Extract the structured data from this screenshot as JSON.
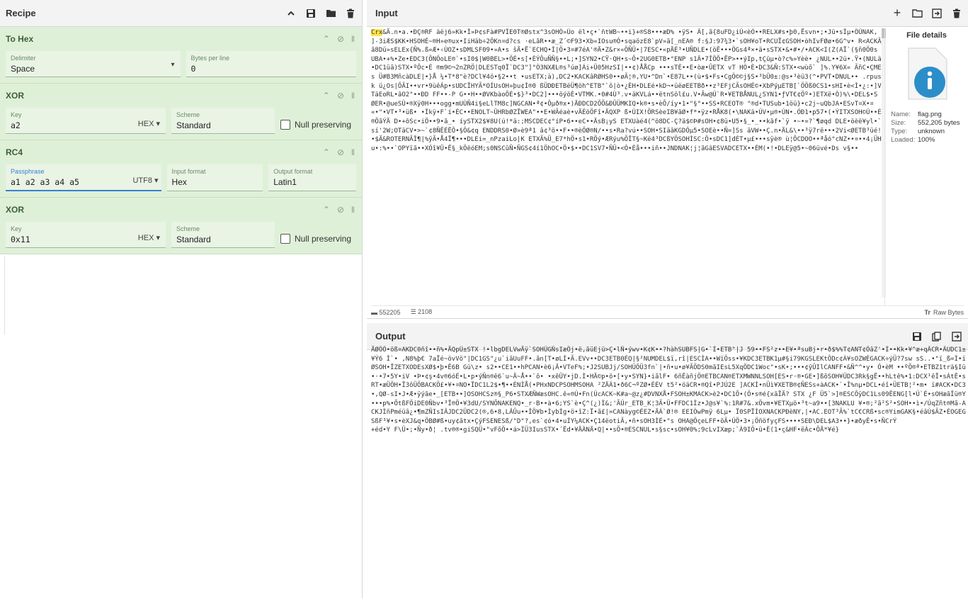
{
  "recipe": {
    "title": "Recipe",
    "operations": [
      {
        "name": "To Hex",
        "fields": [
          {
            "label": "Delimiter",
            "value": "Space"
          },
          {
            "label": "Bytes per line",
            "value": "0"
          }
        ]
      },
      {
        "name": "XOR",
        "key_label": "Key",
        "key_value": "a2",
        "key_format": "HEX",
        "scheme_label": "Scheme",
        "scheme_value": "Standard",
        "null_label": "Null preserving"
      },
      {
        "name": "RC4",
        "passphrase_label": "Passphrase",
        "passphrase_value": "a1 a2 a3 a4 a5",
        "passphrase_format": "UTF8",
        "input_label": "Input format",
        "input_value": "Hex",
        "output_label": "Output format",
        "output_value": "Latin1"
      },
      {
        "name": "XOR",
        "key_label": "Key",
        "key_value": "0x11",
        "key_format": "HEX",
        "scheme_label": "Scheme",
        "scheme_value": "Standard",
        "null_label": "Null preserving"
      }
    ]
  },
  "input": {
    "title": "Input",
    "highlight": "Crx",
    "text": "&Ä.n•a.•ÐÇ®RF äëj6»Kk•Î»Þ¢sFà#PVÎE0T®Østx^3sOHÖ»Üo ël•ç•`ñtWB~••i}+®S8•••æD% •ÿS• Ã[,ã{8uFD¿iÛ<èÒ••RELX#s•þ0,Ësvn•;•Jü•sÎµ•ÖÛNAK, ]-3iÆS$KK•HSOHÉ~®H»e®ux•IiHäb÷2ÖKn¤d?cs ·eLãR••æ_Z´©F93•Xb«IOsu®Ó•sqaözE8`pV»ã[_nEA® f:§J:97¾3•`sOH¥oT•RCUÏ¢GSOH•òhIvFØø•6G^v• R<ACKÃã8Dü»sELEx{Ñ%.ß«Æ•‹ÙOZ•sDMLSF09•»A•s šÄ•Ë`ECHQ•Ì|Ö•3¤#7éA'®Ä•Z&r×«ÖÑÜ•|7ESC•«pÄÉ³•UÑDLE•(öÊ•••ÖGs4ª×•ä•sSTX•&•#•/•ACK<I(Z(AÏ`(§ñ0Ö0s UBA•+%•Ze•EDC3(ÕNÖoLE®`•sI0$|W0BEL>•ÖÉ•s[•ÈÝÔuÑÑ§••L;•]SYN2•CŸ·QH•s~Ô•2UG0ETB•°ENP s1Â•7ÎÖÕ•ËP>••ýIp,tÇüµ•ò?c%»Yèè• ¿NUL••2ü•.Ÿ•(NULä•DC1üã)STX•ºÔc•É ®m9©¬2nZRÖ|DLESTq0Ï`DC3\"]°Ò3NXÆL®s³úø]Ái+Ü05HzSI|••¢)ÅÅCp •••sTÈ••E•òæ•ÛETX vT HÒ•È•DC3&Ñ:STX•<wùõ` ]%.Y¥6X« ÃñC•ÇMEs Ü#B3MñcàDLE|•}Å ¼•T*8\"è?DCl¥4ö•§2••t •usETX;à),DC2•KACKâRØHS0••øÃ¦®,YU•^Dn`•E87L••(ù•$•Fs•CgÖ©©j§S•³bÜ0±:@s•³èü3(^•PVT•DNUL•• .rpusk ü¿Os|ÕÃI••vr•9ùêÁp•sUDCÏHYÃ*OÍUsOH»þu¢Í®0 ßÜDÐETBëÜ¶öh^ETB\"`ô|ò•¿ÈH•DLEé•kD¬•üëøEETBð••z³EFjCÃsOHÉ©•XbPýµETB[`ÖÖß0CS1•sHI•è<Ì•¿:•]VTäEoRL•âO2\"••ÐD FF••-P G••H••ØVKbàoÕÉ•$}³•DC2]•••öýöÈ•VTMK.•0#4Ù³.v•äKVLá••ëtnSöl£u.V•Ãw@Ú`R•¥ETBÅNUL¿SYN1•ƒVT€¢Öº•)ETXë•Ò)%\\•DEL$•S ØER•@ueSÙ•®Xÿ0H•••ogg•mUÙÑ4i§eLlTM8c]NGCAN•ª¢•Ôµð®x•)ÄÐDCD2ÕÕ&ÐÛÜMKIQ•k®•s•èÕ/íy•1•\"§°••SS•RCEOT® \"®d•TUSub•1öü}•c2j~uQbJA•ESvT¤X•¤ «•\"•VT•³•üß• •Îkÿ•F`í•ÈC••ENOLT~ÜHRbØZÏWEA\"••E•WÃéaè•vÄÉöÖFî•ÄQXP ß•ÙIX!ÕRSèeIB¥ãØ•f*•ÿz•RÅK8(•\\NAKä•ÚV•µ®•ÚN•.ÓÐ1•p57•(•ÝITXSOH©Ú••É®ÕãÝÄ D•+ôSc•iÖ••9•ã_• íySTX2$¥8U(ú!*ä:;MSCDEC¢°íP•6••eC••ÄsB¡yS ETXUàé4(^ö8DC-Ç?ä$©Þ#sOH•¢8ü•U5•§_•_••kâf•`ÿ •~•=?`¶øqd DLE•öèë¥yl•`sí'2W;OTäCV•>~`¢8ÑÊÉËÔ•§Ö&¢q ENDDRS0•Ø»è9ª1 â¢³ö••F••®èÖØ®N/••s•Ra?vú••SOH•SIäâKGDÖµ5•SOEè••Ñ=]Ss äVW••Ç.n•ÄL&\\••³ÿ7rë•••2Vi<ØETB³üé!•$Ä&ROTERNÃÎ¶|%ÿÃ•Å4Ï¶•••DLEi=_nPzaiLo|K ETXÃ%Ü_E7*hÖ•s1•RÖý•ÆRýu%ÕÎT§~Kë4³DCßYÖSOHÌSC:Ö•sDC1]dÉT•µ£•••sÿè® ù¦ÕCDOO••ªåó°cNZ••¤••4¡ÜHu•:%••`OPYïã••XÓî¥Ü•Ë§_kÖëóEM;s0NSCûÑ•ÑGS¢4í1ÖhOC•Ö•$••DC1SV7•ÑÜ•<Ó•Èå•••iñ••JNDNAK¦j¦ãGâESVADCETX••ÉM(•!•DLEÿ@5•~06üvé•Ds v§••",
    "length": "552205",
    "lines": "2108",
    "font_label": "Raw Bytes"
  },
  "file_details": {
    "title": "File details",
    "name_label": "Name:",
    "name_value": "flag.png",
    "size_label": "Size:",
    "size_value": "552,205 bytes",
    "type_label": "Type:",
    "type_value": "unknown",
    "loaded_label": "Loaded:",
    "loaded_value": "100%"
  },
  "output": {
    "title": "Output",
    "text": "ÄØÖÕ•öß¤AKDC0ñî••ñ%•ÄQpÜ±STX !•lbgDELVwÄÿ`SOHÜGÑsIæÕj•ë,ãüEjü>Ç•lÑ•ýwv•K¢K••?hàhSUBFS|G•`Í•ETB\"|J 59••FS²z••E¥•ªsuBj•r•ð$%%T¢ANT¢ÕâZ'•Í••Kk•¥^æ+qÃCR•ÃUDC1±¥Ý6 Ì`• ,N8%þ€ 7aÏé~övVö\"|DC1GS\"¿u`iãUuFF•.ãn[T•øLÍ•Ã.EVv••DC3ETB0ÈQ|§²NUMDEL$ï,rî|ESCÌA••WïÖss•¥KDC3ETBK1µ#§i79KGSLEKtÔDc¢À¥sOZWÈGACK÷ýÜ?7sw sS..•\"ï_ß=Ì•ïØSOH•ÏZETXODEsXØ$•þ•Ê6B Gü\\z• s2••CE1••hPCAN•è6¡Ä•VTeF%;•J2SUBJj/SOHÜÖÜ3fn`|•ñ•u•ø¥ÃÖDS0mãIEsL5XqÖDC1Woc\"•sK•;•••¢ŷÛIlCANFF•&Ñ^^•y• Ó•èM ••ºÕ®ª•ETBZ1trä§Iü•·•7•5Y•iV •Þ•¢ş•4v®6óÉ•L•p•ýÑn®ê6`u~Ä~Å••`ô• •xêÜY•jD.Ì•HÄ©p•ö•[•y•SYN}•iãlF• 6ñÊàñjÖ®ETBCAN®ETXMWNNLSOH[ES•r·®•GE•]ßõSOH¥ÜDC3Rk§gË••hLtê%•1:DCX¹êÏ•sÁtÊ•sRT•æÜÖH•Ï3ôÜÖBACKÕ£•¥•¤NO•ÏDC1L2$•¶••ÉNÌÅ(•PHxNDCPSOHMSOHA ²ZÄÁ1•ð6C¬ºZØ•ÉÉV t5²•öäCR•®Qî•PJÚ2E ]ACKÌ•nÜì¥XETB®¢ÑESs+àACK•`•Î%nµ•DCL•éî•ÜETB¦²•m• ï#ACK•DC3•,QØ-sI•J•Æ•ÿýãe•_[ETB••]OSOHCSz®§_P6•STXÆÑWæsOHC.ê«®Ú•Fn(ÚcACK~K#a~@z¿#DVNXÅ•FSOH±KMACK>è2•DC1Õ•(Ö•s®é{xãÏÄ? STX ¿F Ü5`>]®ESCÔÿDC1Ls09ÊENG[l•Ú`É•sOHæãÎü®Y•••p%•ÕtßFÖiDE0Ñbv•³Ï®Ö•¥3dU/SYNÕNAKENQ•_r·B••à•6;YS`è•Ç^(¿)Ì&;'ÃÚr_ETB_K¦3Ã•Ü•FFDC1Ìz•J@s¥`%:1R#7&.xÖvm•¥ETXµö•³t~a9••[3NAKLU ¥•®;²ã²S²•SOH••ì•/ÚqZñt®Mã-ACKJÌñPméüâ¿•¶mZÑIsIÂJDC2ÜDC2(®,6•8,LÂÛu••ÎÖ¥b•ÌybÍg•ö•îZ:Ï•ã£|=CANàyg©ÉEZ•ÄÁ`Ø!® EEIÒwPmÿ 6Lµ• Ï0SPÏÌOXNACKPÐèNY,|•AC.EOT³Ã%`tC€CRß•sc®YimGAK§•éâÙ$ÃZ•ÉOGEGSßF³¥•s•èXJ&q•ÖBØ#ß•uy¢ãtx•ÇýFSENESß/\"D\"?,es`¢ó•4•uÍY¼ACK•Ç14ëotiÃ,•ñ•sOH3ÌÉ•\"s OHA@ÖçeLFF•õÃ•ÚÖ•3•¡ÖñöfyçFS••••SEÐ\\DEL$A3••}•æðyÊ•s•ÑCrÝ",
    "more": "+éd•Y F\\Ü•;•Ñy•ð¦ .tv®®•giSQÜ•\"vFõÖ••á>ÍÜ3IusSTX•´Ëd•¥ÄÀNÄ•Q|••sÖ•®ESCNUL•s§sc•sOH¥0%;9cLvIXæp;`À9IÖ•ü•È(1•ç&HF•ëÀc•ÕÄ*¥é}"
  }
}
